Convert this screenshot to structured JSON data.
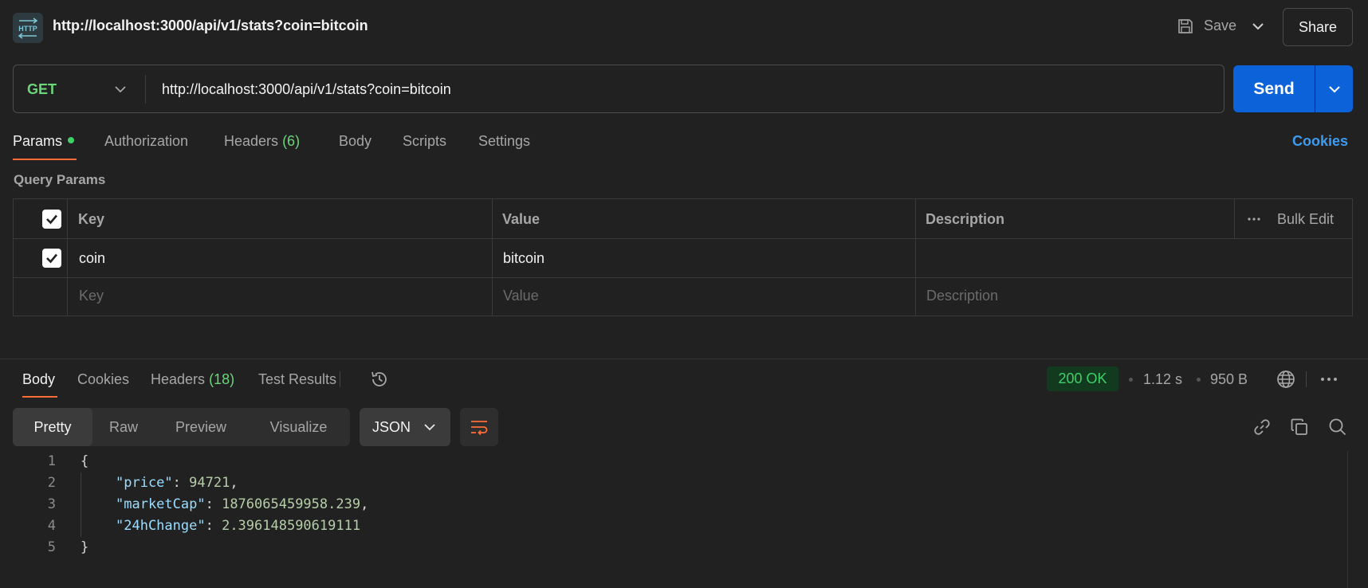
{
  "header": {
    "icon_text": "HTTP",
    "title": "http://localhost:3000/api/v1/stats?coin=bitcoin",
    "save_label": "Save",
    "share_label": "Share"
  },
  "request": {
    "method": "GET",
    "url": "http://localhost:3000/api/v1/stats?coin=bitcoin",
    "send_label": "Send"
  },
  "request_tabs": {
    "params": "Params",
    "authorization": "Authorization",
    "headers": "Headers",
    "headers_count": "(6)",
    "body": "Body",
    "scripts": "Scripts",
    "settings": "Settings",
    "cookies": "Cookies"
  },
  "query_params": {
    "title": "Query Params",
    "columns": {
      "key": "Key",
      "value": "Value",
      "description": "Description"
    },
    "bulk_edit": "Bulk Edit",
    "rows": [
      {
        "checked": true,
        "key": "coin",
        "value": "bitcoin",
        "description": ""
      }
    ],
    "placeholders": {
      "key": "Key",
      "value": "Value",
      "description": "Description"
    }
  },
  "response_tabs": {
    "body": "Body",
    "cookies": "Cookies",
    "headers": "Headers",
    "headers_count": "(18)",
    "test_results": "Test Results"
  },
  "response_meta": {
    "status": "200 OK",
    "time": "1.12 s",
    "size": "950 B"
  },
  "view_modes": [
    "Pretty",
    "Raw",
    "Preview",
    "Visualize"
  ],
  "format": "JSON",
  "code": {
    "line_numbers": [
      "1",
      "2",
      "3",
      "4",
      "5"
    ],
    "open_brace": "{",
    "close_brace": "}",
    "fields": [
      {
        "key": "\"price\"",
        "value": "94721",
        "trail": ","
      },
      {
        "key": "\"marketCap\"",
        "value": "1876065459958.239",
        "trail": ","
      },
      {
        "key": "\"24hChange\"",
        "value": "2.396148590619111",
        "trail": ""
      }
    ]
  },
  "colors": {
    "accent": "#ff6c37",
    "send": "#0c62d8",
    "success": "#3fcf67",
    "link": "#3d9bf0"
  }
}
